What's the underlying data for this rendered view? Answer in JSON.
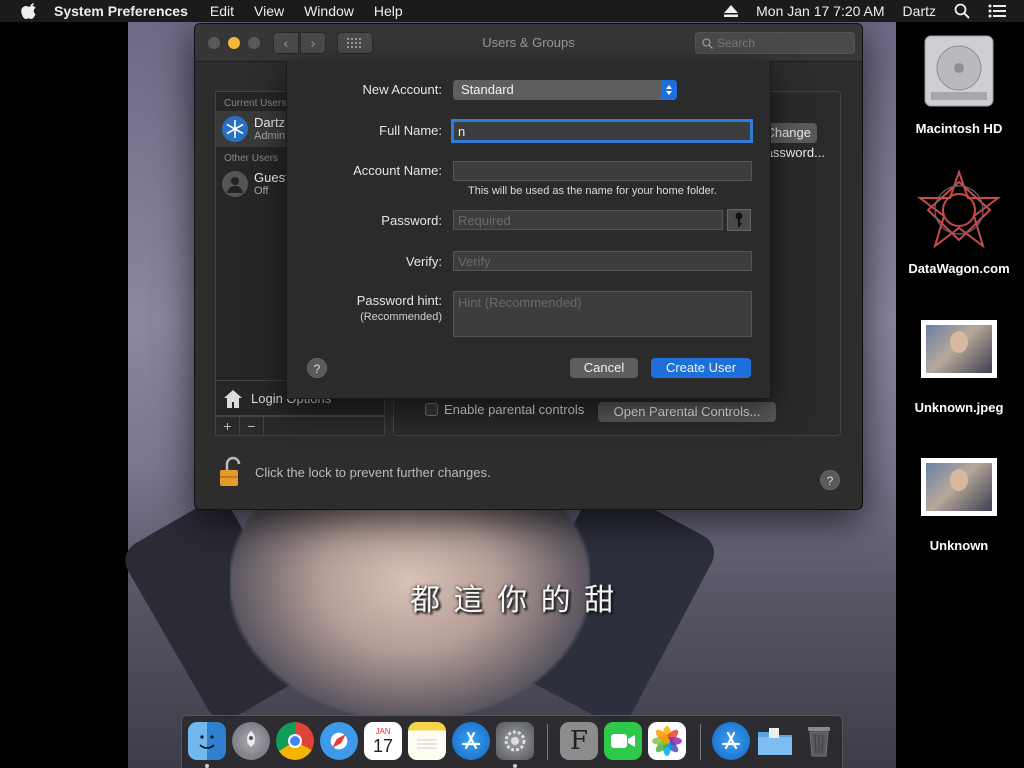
{
  "menubar": {
    "app_name": "System Preferences",
    "menus": [
      "Edit",
      "View",
      "Window",
      "Help"
    ],
    "datetime": "Mon Jan 17  7:20 AM",
    "user": "Dartz"
  },
  "window": {
    "title": "Users & Groups",
    "search_placeholder": "Search",
    "current_users_label": "Current Users",
    "other_users_label": "Other Users",
    "users": [
      {
        "name": "Dartz",
        "role": "Admin"
      },
      {
        "name": "Guest User",
        "role": "Off"
      }
    ],
    "login_options": "Login Options",
    "add_label": "+",
    "remove_label": "−",
    "change_password_label": "Change Password...",
    "parental_checkbox_label": "Enable parental controls",
    "open_parental_label": "Open Parental Controls...",
    "lock_text": "Click the lock to prevent further changes.",
    "help_label": "?"
  },
  "sheet": {
    "new_account_label": "New Account:",
    "new_account_value": "Standard",
    "full_name_label": "Full Name:",
    "full_name_value": "n",
    "account_name_label": "Account Name:",
    "account_name_value": "",
    "account_name_hint": "This will be used as the name for your home folder.",
    "password_label": "Password:",
    "password_placeholder": "Required",
    "verify_label": "Verify:",
    "verify_placeholder": "Verify",
    "password_hint_label": "Password hint:",
    "password_hint_sublabel": "(Recommended)",
    "password_hint_placeholder": "Hint (Recommended)",
    "help_label": "?",
    "cancel_label": "Cancel",
    "create_label": "Create User"
  },
  "desktop": {
    "icons": [
      {
        "label": "Macintosh HD"
      },
      {
        "label": "DataWagon.com"
      },
      {
        "label": "Unknown.jpeg"
      },
      {
        "label": "Unknown"
      }
    ],
    "wallpaper_caption": "都 這 你 的 甜"
  },
  "dock": {
    "apps": [
      "Finder",
      "Launchpad",
      "Chrome",
      "Safari",
      "Calendar",
      "Notes",
      "App Store",
      "System Preferences",
      "Font Book",
      "FaceTime",
      "Photos",
      "App Store",
      "Downloads",
      "Trash"
    ],
    "calendar_month": "JAN",
    "calendar_day": "17",
    "fontbook_letter": "F"
  },
  "colors": {
    "accent": "#1e6fd9",
    "focus_ring": "#2f7dd8",
    "minimize": "#f5b83a"
  }
}
